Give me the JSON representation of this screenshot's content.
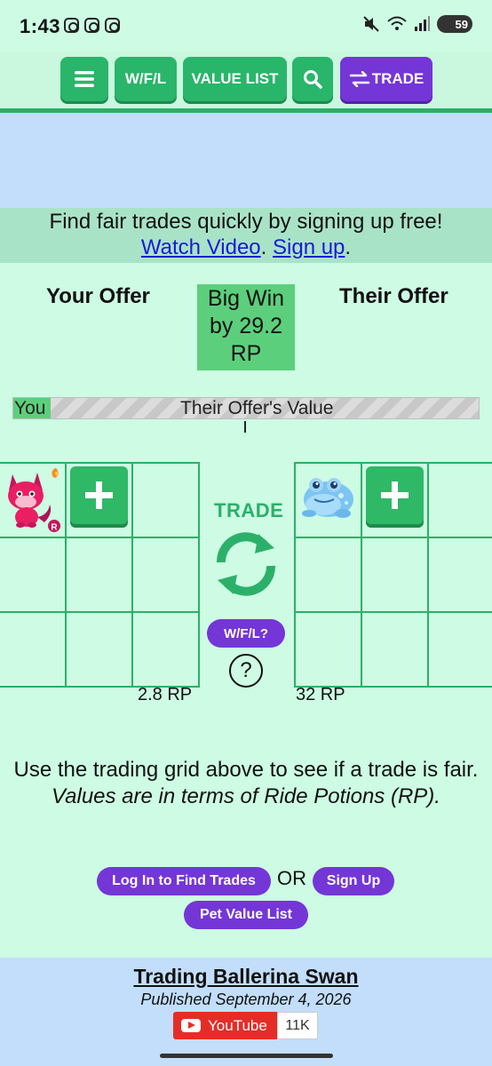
{
  "status_bar": {
    "time": "1:43",
    "battery": "59",
    "signal": "5"
  },
  "nav": {
    "menu_icon": "hamburger-menu-icon",
    "wfl": "W/F/L",
    "value_list": "VALUE LIST",
    "search_icon": "search-icon",
    "trade": "TRADE",
    "trade_icon": "swap-arrows-icon",
    "colors": {
      "green": "#29b56a",
      "purple": "#7436d6"
    }
  },
  "signup_band": {
    "text": "Find fair trades quickly by signing up free!",
    "watch_video": "Watch Video",
    "sep": ".",
    "sign_up": "Sign up",
    "end": "."
  },
  "offers": {
    "your_offer": "Your Offer",
    "their_offer": "Their Offer",
    "result": {
      "line1": "Big Win",
      "line2": "by 29.2",
      "line3": "RP"
    },
    "value_bar": {
      "you_label": "You",
      "their_label": "Their Offer's Value",
      "you_fraction": 0.08
    }
  },
  "your_grid": {
    "item": {
      "name": "pink-fox-pet",
      "badge": "R"
    },
    "total": "2.8 RP"
  },
  "their_grid": {
    "item": {
      "name": "ice-blue-frog-pet"
    },
    "total": "32 RP"
  },
  "middle": {
    "trade_word": "TRADE",
    "trade_icon": "refresh-cycle-icon",
    "wfl_button": "W/F/L?",
    "help": "?"
  },
  "info": {
    "line1": "Use the trading grid above to see if a trade is fair.",
    "line2": "Values are in terms of Ride Potions (RP)."
  },
  "actions": {
    "login": "Log In to Find Trades",
    "or": "OR",
    "signup": "Sign Up",
    "value_list": "Pet Value List"
  },
  "footer": {
    "title": "Trading Ballerina Swan",
    "date": "Published September 4, 2026",
    "youtube": "YouTube",
    "count": "11K"
  }
}
